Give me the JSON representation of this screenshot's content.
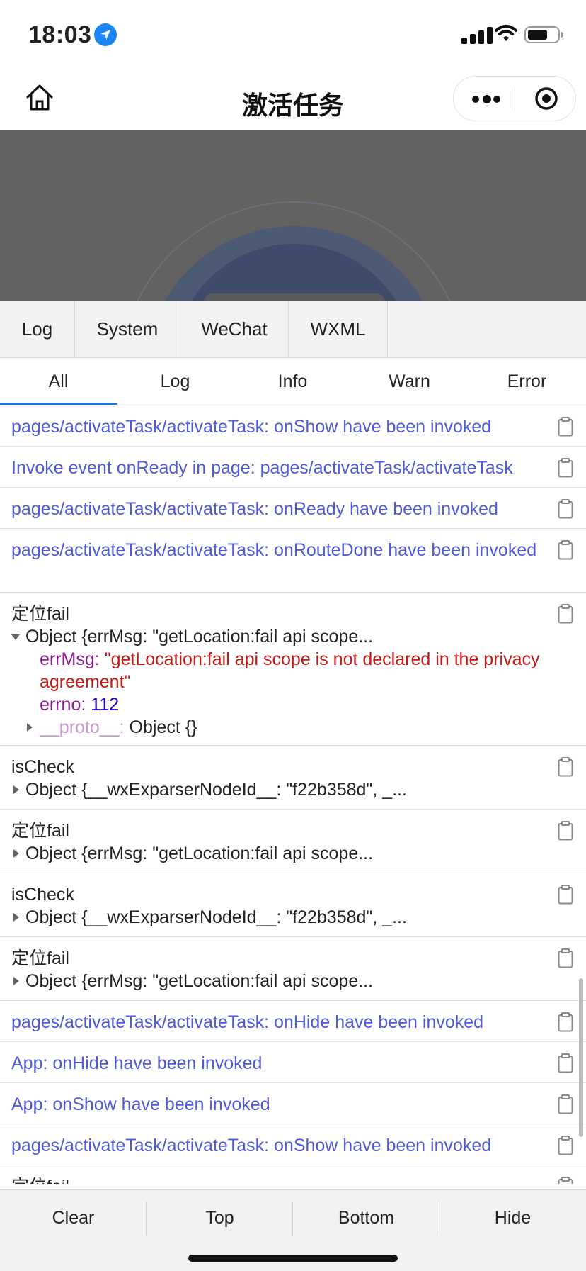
{
  "status_bar": {
    "time": "18:03"
  },
  "nav": {
    "title": "激活任务"
  },
  "tabs": [
    "Log",
    "System",
    "WeChat",
    "WXML"
  ],
  "filters": [
    "All",
    "Log",
    "Info",
    "Warn",
    "Error"
  ],
  "active_filter": "All",
  "logs": [
    {
      "type": "text",
      "text": "pages/activateTask/activateTask: onShow have been invoked"
    },
    {
      "type": "text",
      "text": "Invoke event onReady in page: pages/activateTask/activateTask"
    },
    {
      "type": "text",
      "text": "pages/activateTask/activateTask: onReady have been invoked"
    },
    {
      "type": "text",
      "text": "pages/activateTask/activateTask: onRouteDone have been invoked"
    },
    {
      "type": "expanded",
      "label": "定位fail",
      "summary": "Object {errMsg: \"getLocation:fail api scope...",
      "props": [
        {
          "key": "errMsg",
          "value": "\"getLocation:fail api scope is not declared in the privacy agreement\""
        },
        {
          "key": "errno",
          "value": "112"
        }
      ],
      "proto_key": "__proto__",
      "proto_value": "Object {}"
    },
    {
      "type": "collapsed",
      "label": "isCheck",
      "summary": "Object {__wxExparserNodeId__: \"f22b358d\", _..."
    },
    {
      "type": "collapsed",
      "label": "定位fail",
      "summary": "Object {errMsg: \"getLocation:fail api scope..."
    },
    {
      "type": "collapsed",
      "label": "isCheck",
      "summary": "Object {__wxExparserNodeId__: \"f22b358d\", _..."
    },
    {
      "type": "collapsed",
      "label": "定位fail",
      "summary": "Object {errMsg: \"getLocation:fail api scope..."
    },
    {
      "type": "text",
      "text": "pages/activateTask/activateTask: onHide have been invoked"
    },
    {
      "type": "text",
      "text": "App: onHide have been invoked"
    },
    {
      "type": "text",
      "text": "App: onShow have been invoked"
    },
    {
      "type": "text",
      "text": "pages/activateTask/activateTask: onShow have been invoked"
    },
    {
      "type": "label_only",
      "label": "定位fail"
    }
  ],
  "footer": [
    "Clear",
    "Top",
    "Bottom",
    "Hide"
  ],
  "colors": {
    "log_blue": "#4e5ad6",
    "accent": "#1a73e8",
    "location": "#1a86f8"
  },
  "icons": [
    "location-arrow-icon",
    "signal-icon",
    "wifi-icon",
    "battery-icon",
    "home-icon",
    "more-icon",
    "close-target-icon",
    "clipboard-icon"
  ]
}
